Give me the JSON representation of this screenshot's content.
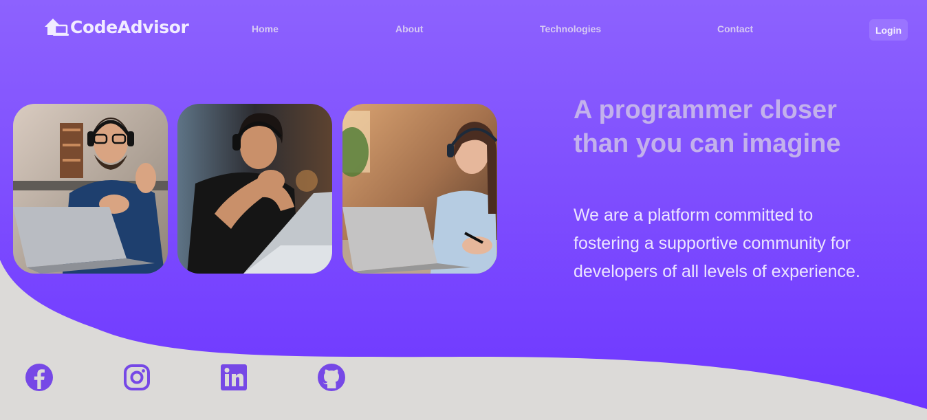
{
  "app": {
    "brand": "CodeAdvisor"
  },
  "nav": {
    "home": "Home",
    "about": "About",
    "technologies": "Technologies",
    "contact": "Contact",
    "login": "Login"
  },
  "hero": {
    "headline": "A programmer closer than you can imagine",
    "description": "We are a platform committed to fostering a supportive community for developers of all levels of experience.",
    "photos": [
      {
        "icon": "photo-developer-man-headphones-laptop"
      },
      {
        "icon": "photo-developer-man-thinking-laptop"
      },
      {
        "icon": "photo-developer-woman-headphones-laptop"
      }
    ]
  },
  "social": [
    {
      "icon": "facebook-icon"
    },
    {
      "icon": "instagram-icon"
    },
    {
      "icon": "linkedin-icon"
    },
    {
      "icon": "github-icon"
    }
  ],
  "colors": {
    "hero_top": "#8d62fe",
    "hero_bottom": "#7038ff",
    "footer_band": "#dcdad8",
    "social_icon": "#7648e6"
  }
}
